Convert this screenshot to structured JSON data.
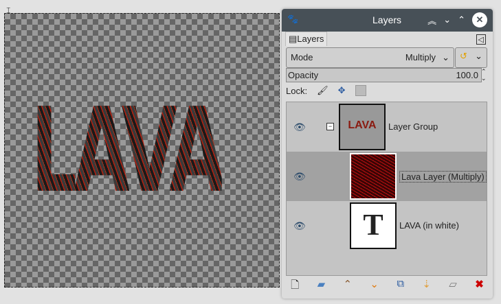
{
  "canvas": {
    "text": "LAVA"
  },
  "dock": {
    "title": "Layers",
    "tab": "Layers",
    "mode_label": "Mode",
    "mode_value": "Multiply",
    "opacity_label": "Opacity",
    "opacity_value": "100.0",
    "lock_label": "Lock:"
  },
  "layers": [
    {
      "name": "Layer Group",
      "selected": false,
      "thumb_text": "LAVA"
    },
    {
      "name": "Lava Layer (Multiply)",
      "selected": true
    },
    {
      "name": "LAVA (in white)",
      "selected": false,
      "thumb_text": "T"
    }
  ],
  "colors": {
    "titlebar": "#475057",
    "selection": "#a2a2a2",
    "accent": "#e07b10",
    "delete": "#cc0000"
  }
}
